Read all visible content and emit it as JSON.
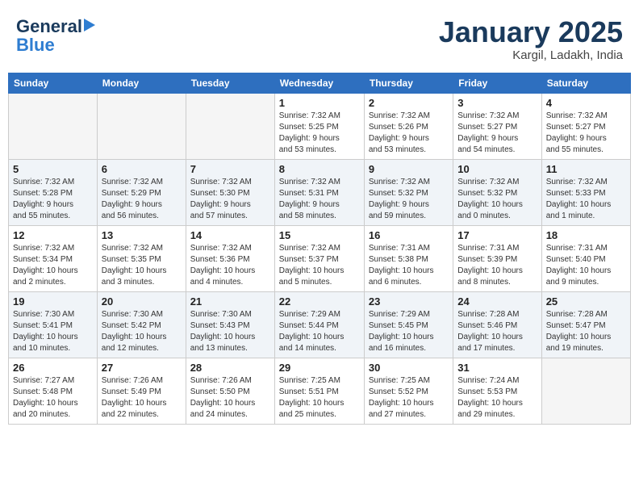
{
  "header": {
    "logo_general": "General",
    "logo_blue": "Blue",
    "month_title": "January 2025",
    "location": "Kargil, Ladakh, India"
  },
  "weekdays": [
    "Sunday",
    "Monday",
    "Tuesday",
    "Wednesday",
    "Thursday",
    "Friday",
    "Saturday"
  ],
  "weeks": [
    [
      {
        "day": "",
        "info": ""
      },
      {
        "day": "",
        "info": ""
      },
      {
        "day": "",
        "info": ""
      },
      {
        "day": "1",
        "info": "Sunrise: 7:32 AM\nSunset: 5:25 PM\nDaylight: 9 hours\nand 53 minutes."
      },
      {
        "day": "2",
        "info": "Sunrise: 7:32 AM\nSunset: 5:26 PM\nDaylight: 9 hours\nand 53 minutes."
      },
      {
        "day": "3",
        "info": "Sunrise: 7:32 AM\nSunset: 5:27 PM\nDaylight: 9 hours\nand 54 minutes."
      },
      {
        "day": "4",
        "info": "Sunrise: 7:32 AM\nSunset: 5:27 PM\nDaylight: 9 hours\nand 55 minutes."
      }
    ],
    [
      {
        "day": "5",
        "info": "Sunrise: 7:32 AM\nSunset: 5:28 PM\nDaylight: 9 hours\nand 55 minutes."
      },
      {
        "day": "6",
        "info": "Sunrise: 7:32 AM\nSunset: 5:29 PM\nDaylight: 9 hours\nand 56 minutes."
      },
      {
        "day": "7",
        "info": "Sunrise: 7:32 AM\nSunset: 5:30 PM\nDaylight: 9 hours\nand 57 minutes."
      },
      {
        "day": "8",
        "info": "Sunrise: 7:32 AM\nSunset: 5:31 PM\nDaylight: 9 hours\nand 58 minutes."
      },
      {
        "day": "9",
        "info": "Sunrise: 7:32 AM\nSunset: 5:32 PM\nDaylight: 9 hours\nand 59 minutes."
      },
      {
        "day": "10",
        "info": "Sunrise: 7:32 AM\nSunset: 5:32 PM\nDaylight: 10 hours\nand 0 minutes."
      },
      {
        "day": "11",
        "info": "Sunrise: 7:32 AM\nSunset: 5:33 PM\nDaylight: 10 hours\nand 1 minute."
      }
    ],
    [
      {
        "day": "12",
        "info": "Sunrise: 7:32 AM\nSunset: 5:34 PM\nDaylight: 10 hours\nand 2 minutes."
      },
      {
        "day": "13",
        "info": "Sunrise: 7:32 AM\nSunset: 5:35 PM\nDaylight: 10 hours\nand 3 minutes."
      },
      {
        "day": "14",
        "info": "Sunrise: 7:32 AM\nSunset: 5:36 PM\nDaylight: 10 hours\nand 4 minutes."
      },
      {
        "day": "15",
        "info": "Sunrise: 7:32 AM\nSunset: 5:37 PM\nDaylight: 10 hours\nand 5 minutes."
      },
      {
        "day": "16",
        "info": "Sunrise: 7:31 AM\nSunset: 5:38 PM\nDaylight: 10 hours\nand 6 minutes."
      },
      {
        "day": "17",
        "info": "Sunrise: 7:31 AM\nSunset: 5:39 PM\nDaylight: 10 hours\nand 8 minutes."
      },
      {
        "day": "18",
        "info": "Sunrise: 7:31 AM\nSunset: 5:40 PM\nDaylight: 10 hours\nand 9 minutes."
      }
    ],
    [
      {
        "day": "19",
        "info": "Sunrise: 7:30 AM\nSunset: 5:41 PM\nDaylight: 10 hours\nand 10 minutes."
      },
      {
        "day": "20",
        "info": "Sunrise: 7:30 AM\nSunset: 5:42 PM\nDaylight: 10 hours\nand 12 minutes."
      },
      {
        "day": "21",
        "info": "Sunrise: 7:30 AM\nSunset: 5:43 PM\nDaylight: 10 hours\nand 13 minutes."
      },
      {
        "day": "22",
        "info": "Sunrise: 7:29 AM\nSunset: 5:44 PM\nDaylight: 10 hours\nand 14 minutes."
      },
      {
        "day": "23",
        "info": "Sunrise: 7:29 AM\nSunset: 5:45 PM\nDaylight: 10 hours\nand 16 minutes."
      },
      {
        "day": "24",
        "info": "Sunrise: 7:28 AM\nSunset: 5:46 PM\nDaylight: 10 hours\nand 17 minutes."
      },
      {
        "day": "25",
        "info": "Sunrise: 7:28 AM\nSunset: 5:47 PM\nDaylight: 10 hours\nand 19 minutes."
      }
    ],
    [
      {
        "day": "26",
        "info": "Sunrise: 7:27 AM\nSunset: 5:48 PM\nDaylight: 10 hours\nand 20 minutes."
      },
      {
        "day": "27",
        "info": "Sunrise: 7:26 AM\nSunset: 5:49 PM\nDaylight: 10 hours\nand 22 minutes."
      },
      {
        "day": "28",
        "info": "Sunrise: 7:26 AM\nSunset: 5:50 PM\nDaylight: 10 hours\nand 24 minutes."
      },
      {
        "day": "29",
        "info": "Sunrise: 7:25 AM\nSunset: 5:51 PM\nDaylight: 10 hours\nand 25 minutes."
      },
      {
        "day": "30",
        "info": "Sunrise: 7:25 AM\nSunset: 5:52 PM\nDaylight: 10 hours\nand 27 minutes."
      },
      {
        "day": "31",
        "info": "Sunrise: 7:24 AM\nSunset: 5:53 PM\nDaylight: 10 hours\nand 29 minutes."
      },
      {
        "day": "",
        "info": ""
      }
    ]
  ]
}
